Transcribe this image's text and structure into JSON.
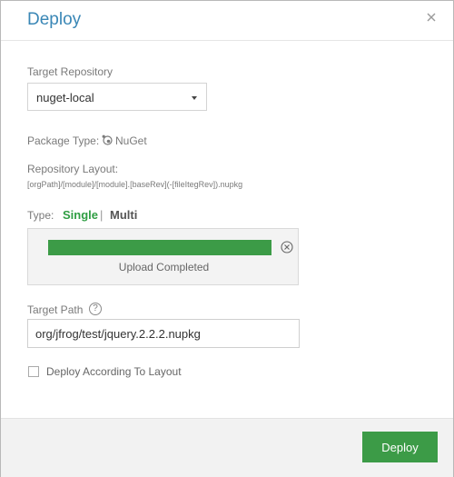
{
  "dialog": {
    "title": "Deploy",
    "close_icon": "close-icon"
  },
  "target_repository": {
    "label": "Target Repository",
    "selected": "nuget-local"
  },
  "package_type": {
    "label": "Package Type:",
    "icon": "nuget-icon",
    "value": "NuGet"
  },
  "repository_layout": {
    "label": "Repository Layout:",
    "pattern": "[orgPath]/[module]/[module].[baseRev](-[fileItegRev]).nupkg"
  },
  "type": {
    "label": "Type:",
    "single": "Single",
    "separator": "|",
    "multi": "Multi",
    "selected": "Single"
  },
  "upload": {
    "progress": 1.0,
    "status": "Upload Completed",
    "cancel_icon": "cancel-circle-icon",
    "color": "#3c9b47"
  },
  "target_path": {
    "label": "Target Path",
    "help_icon": "help-icon",
    "help_glyph": "?",
    "value": "org/jfrog/test/jquery.2.2.2.nupkg"
  },
  "deploy_according_to_layout": {
    "label": "Deploy According To Layout",
    "checked": false
  },
  "footer": {
    "deploy_label": "Deploy"
  },
  "colors": {
    "title": "#3a87b6",
    "accent_green": "#3c9b47"
  }
}
